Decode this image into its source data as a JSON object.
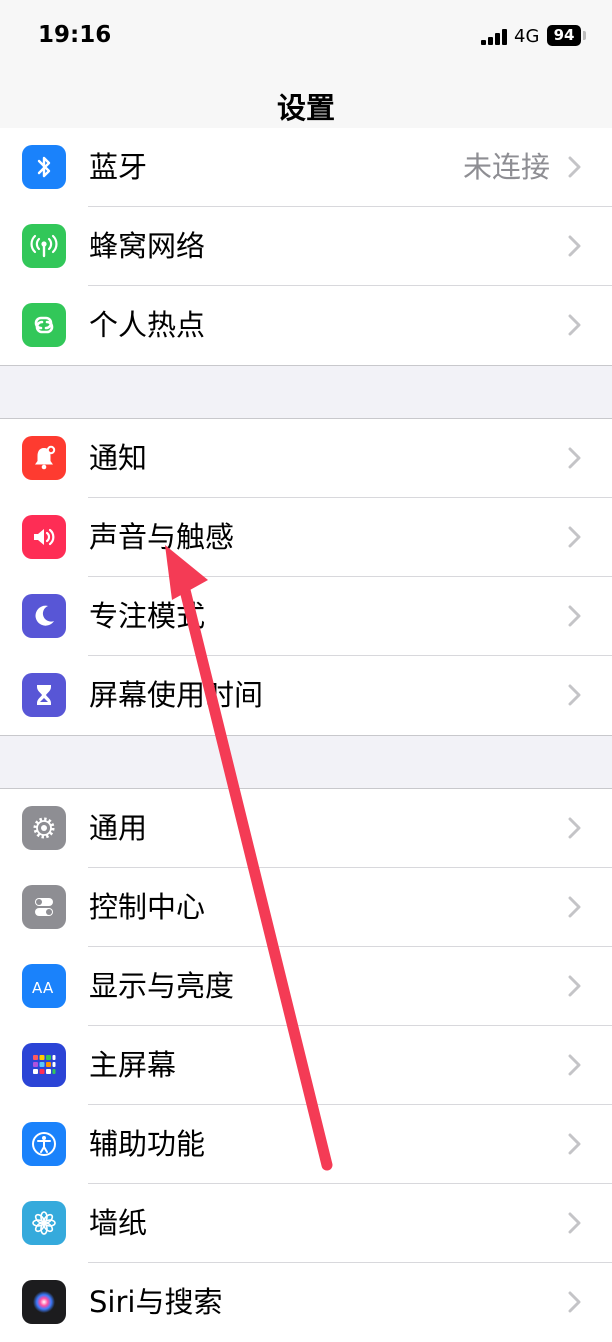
{
  "status": {
    "time": "19:16",
    "network": "4G",
    "battery": "94"
  },
  "nav": {
    "title": "设置"
  },
  "group1": [
    {
      "label": "蓝牙",
      "value": "未连接",
      "icon": "bluetooth-icon",
      "color": "#1a82fb"
    },
    {
      "label": "蜂窝网络",
      "value": "",
      "icon": "cellular-antenna-icon",
      "color": "#32c759"
    },
    {
      "label": "个人热点",
      "value": "",
      "icon": "hotspot-link-icon",
      "color": "#32c759"
    }
  ],
  "group2": [
    {
      "label": "通知",
      "icon": "notification-bell-icon",
      "color": "#fe3b30"
    },
    {
      "label": "声音与触感",
      "icon": "speaker-icon",
      "color": "#fe2d55"
    },
    {
      "label": "专注模式",
      "icon": "moon-icon",
      "color": "#5856d6"
    },
    {
      "label": "屏幕使用时间",
      "icon": "hourglass-icon",
      "color": "#5856d6"
    }
  ],
  "group3": [
    {
      "label": "通用",
      "icon": "gear-icon",
      "color": "#8e8e93"
    },
    {
      "label": "控制中心",
      "icon": "toggle-switches-icon",
      "color": "#8e8e93"
    },
    {
      "label": "显示与亮度",
      "icon": "text-size-aa-icon",
      "color": "#1a82fb"
    },
    {
      "label": "主屏幕",
      "icon": "home-screen-grid-icon",
      "color": "#2b44d6"
    },
    {
      "label": "辅助功能",
      "icon": "accessibility-person-icon",
      "color": "#1a82fb"
    },
    {
      "label": "墙纸",
      "icon": "flower-icon",
      "color": "#35aadc"
    },
    {
      "label": "Siri与搜索",
      "icon": "siri-orb-icon",
      "color": "#1c1c1e"
    }
  ],
  "annotation": {
    "arrow_color": "#f43b55"
  }
}
